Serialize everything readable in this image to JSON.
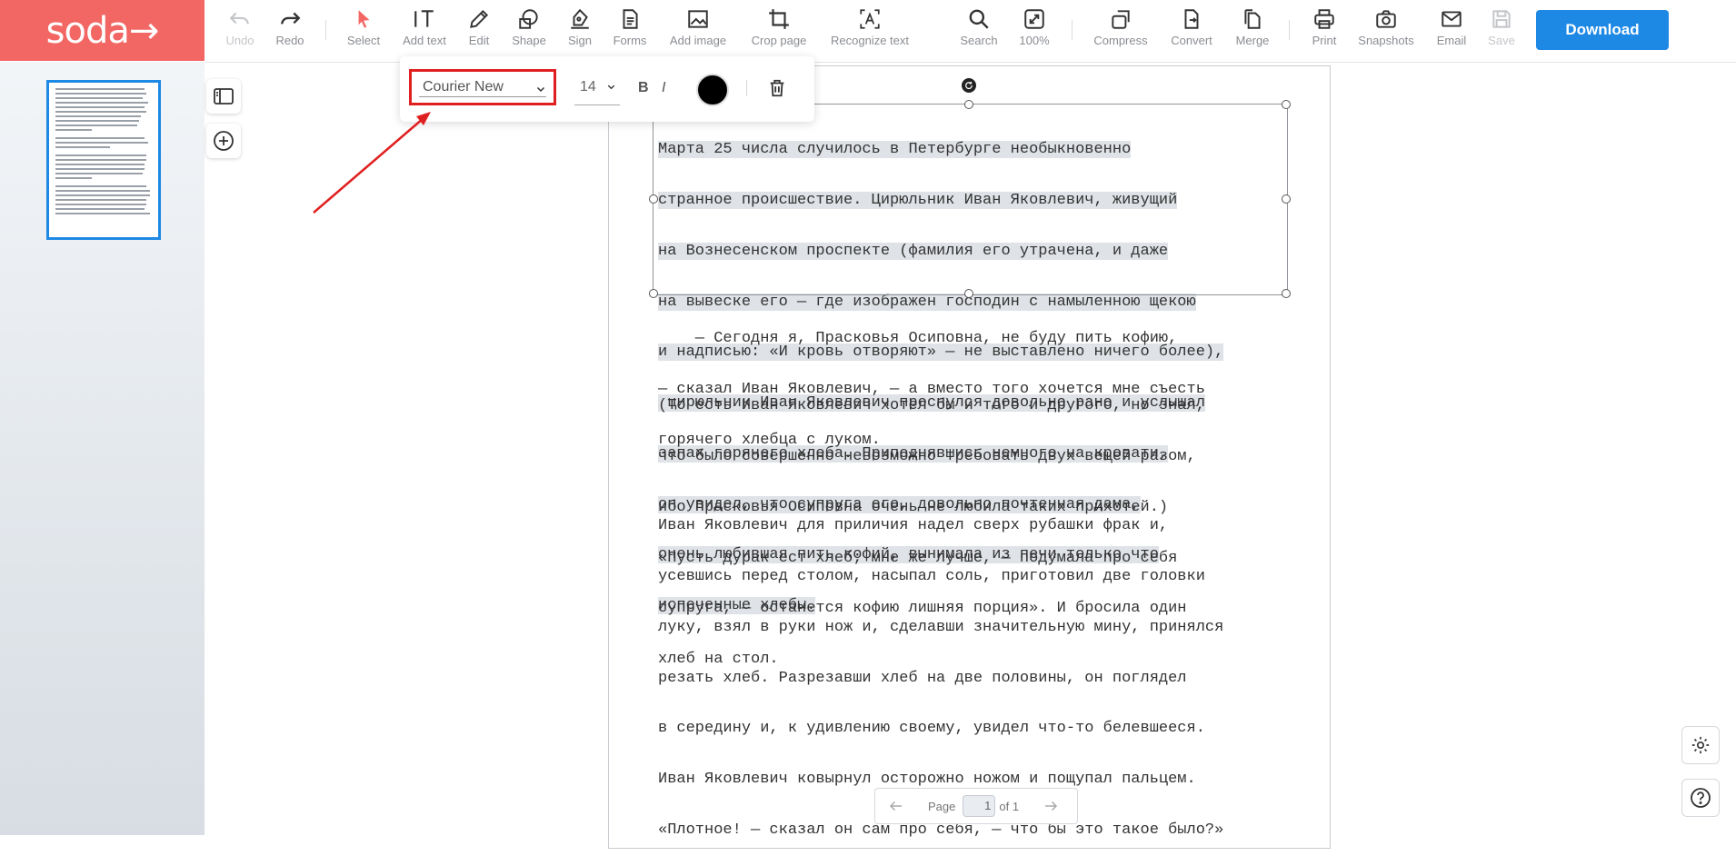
{
  "app": {
    "logo": "soda→"
  },
  "toolbar": {
    "tools": [
      {
        "id": "undo",
        "label": "Undo",
        "icon": "undo-icon",
        "disabled": true
      },
      {
        "id": "redo",
        "label": "Redo",
        "icon": "redo-icon",
        "disabled": false
      },
      {
        "id": "select",
        "label": "Select",
        "icon": "cursor-icon",
        "disabled": false
      },
      {
        "id": "add-text",
        "label": "Add text",
        "icon": "add-text-icon",
        "disabled": false
      },
      {
        "id": "edit",
        "label": "Edit",
        "icon": "pencil-icon",
        "disabled": false
      },
      {
        "id": "shape",
        "label": "Shape",
        "icon": "shape-icon",
        "disabled": false
      },
      {
        "id": "sign",
        "label": "Sign",
        "icon": "pen-nib-icon",
        "disabled": false
      },
      {
        "id": "forms",
        "label": "Forms",
        "icon": "form-icon",
        "disabled": false
      },
      {
        "id": "add-image",
        "label": "Add image",
        "icon": "image-icon",
        "disabled": false
      },
      {
        "id": "crop-page",
        "label": "Crop page",
        "icon": "crop-icon",
        "disabled": false
      },
      {
        "id": "recognize-text",
        "label": "Recognize text",
        "icon": "ocr-icon",
        "disabled": false
      },
      {
        "id": "search",
        "label": "Search",
        "icon": "search-icon",
        "disabled": false
      },
      {
        "id": "zoom",
        "label": "100%",
        "icon": "zoom-icon",
        "disabled": false
      },
      {
        "id": "compress",
        "label": "Compress",
        "icon": "compress-icon",
        "disabled": false
      },
      {
        "id": "convert",
        "label": "Convert",
        "icon": "convert-icon",
        "disabled": false
      },
      {
        "id": "merge",
        "label": "Merge",
        "icon": "merge-icon",
        "disabled": false
      },
      {
        "id": "print",
        "label": "Print",
        "icon": "printer-icon",
        "disabled": false
      },
      {
        "id": "snapshots",
        "label": "Snapshots",
        "icon": "camera-icon",
        "disabled": false
      },
      {
        "id": "email",
        "label": "Email",
        "icon": "envelope-icon",
        "disabled": false
      },
      {
        "id": "save",
        "label": "Save",
        "icon": "floppy-icon",
        "disabled": true
      }
    ],
    "download_label": "Download"
  },
  "text_toolbar": {
    "font": "Courier New",
    "size": "14",
    "bold_label": "B",
    "italic_label": "I",
    "color": "#000000"
  },
  "document": {
    "selected_lines": [
      "Марта 25 числа случилось в Петербурге необыкновенно",
      "странное происшествие. Цирюльник Иван Яковлевич, живущий",
      "на Вознесенском проспекте (фамилия его утрачена, и даже",
      "на вывеске его — где изображен господин с намыленною щекою",
      "и надписью: «И кровь отворяют» — не выставлено ничего более),",
      " цирюльник Иван Яковлевич проснулся довольно рано и услышал",
      "запах горячего хлеба. Приподнявшись немного на кровати,",
      "он увидел, что супруга его, довольно почтенная дама,",
      "очень любившая пить кофий, вынимала из печи только что",
      "испеченные хлебы."
    ],
    "paragraph1": [
      "    — Сегодня я, Прасковья Осиповна, не буду пить кофию,",
      "— сказал Иван Яковлевич, — а вместо того хочется мне съесть",
      "горячего хлебца с луком."
    ],
    "paragraph2": [
      "(То есть Иван Яковлевич хотел бы и того и другого, но знал,",
      "что было совершенно невозможно требовать двух вещей разом,",
      "ибо Прасковья Осиповна очень не любила таких прихотей.)",
      "«Пусть дурак ест хлеб; мне же лучше, — подумала про себя",
      "супруга, — останется кофию лишняя порция». И бросила один",
      "хлеб на стол."
    ],
    "paragraph3": [
      "Иван Яковлевич для приличия надел сверх рубашки фрак и,",
      "усевшись перед столом, насыпал соль, приготовил две головки",
      "луку, взял в руки нож и, сделавши значительную мину, принялся",
      "резать хлеб. Разрезавши хлеб на две половины, он поглядел",
      "в середину и, к удивлению своему, увидел что-то белевшееся.",
      "Иван Яковлевич ковырнул осторожно ножом и пощупал пальцем.",
      "«Плотное! — сказал он сам про себя, — что бы это такое было?»"
    ]
  },
  "pager": {
    "label": "Page",
    "current": "1",
    "total_text": "of 1"
  },
  "colors": {
    "brand": "#f26663",
    "accent": "#1e88e5",
    "annotation": "#e02020"
  }
}
